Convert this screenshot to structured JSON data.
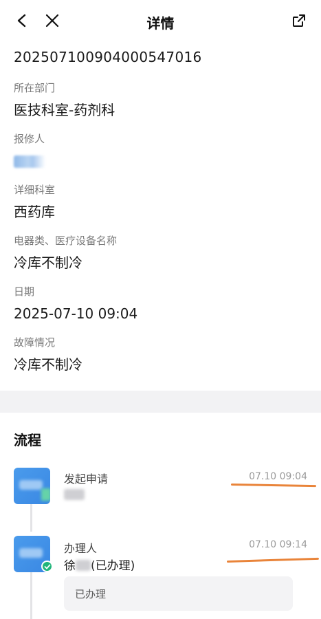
{
  "nav": {
    "title": "详情",
    "back_icon": "chevron-left-icon",
    "close_icon": "close-icon",
    "share_icon": "external-link-icon"
  },
  "order_number": "20250710090400054701‍6",
  "fields": [
    {
      "label": "所在部门",
      "value": "医技科室-药剂科"
    },
    {
      "label": "报修人",
      "value": ""
    },
    {
      "label": "详细科室",
      "value": "西药库"
    },
    {
      "label": "电器类、医疗设备名称",
      "value": "冷库不制冷"
    },
    {
      "label": "日期",
      "value": "2025-07-10 09:04"
    },
    {
      "label": "故障情况",
      "value": "冷库不制冷"
    }
  ],
  "process": {
    "title": "流程",
    "steps": [
      {
        "title": "发起申请",
        "time": "07.10 09:04",
        "name_prefix": "",
        "name_suffix": ""
      },
      {
        "title": "办理人",
        "time": "07.10 09:14",
        "name_prefix": "徐",
        "name_suffix": "(已办理)",
        "comment": "已办理"
      }
    ]
  },
  "colors": {
    "accent": "#3a88e3",
    "success": "#20b57a",
    "annotation": "#e9843a",
    "divider": "#f2f2f4"
  }
}
